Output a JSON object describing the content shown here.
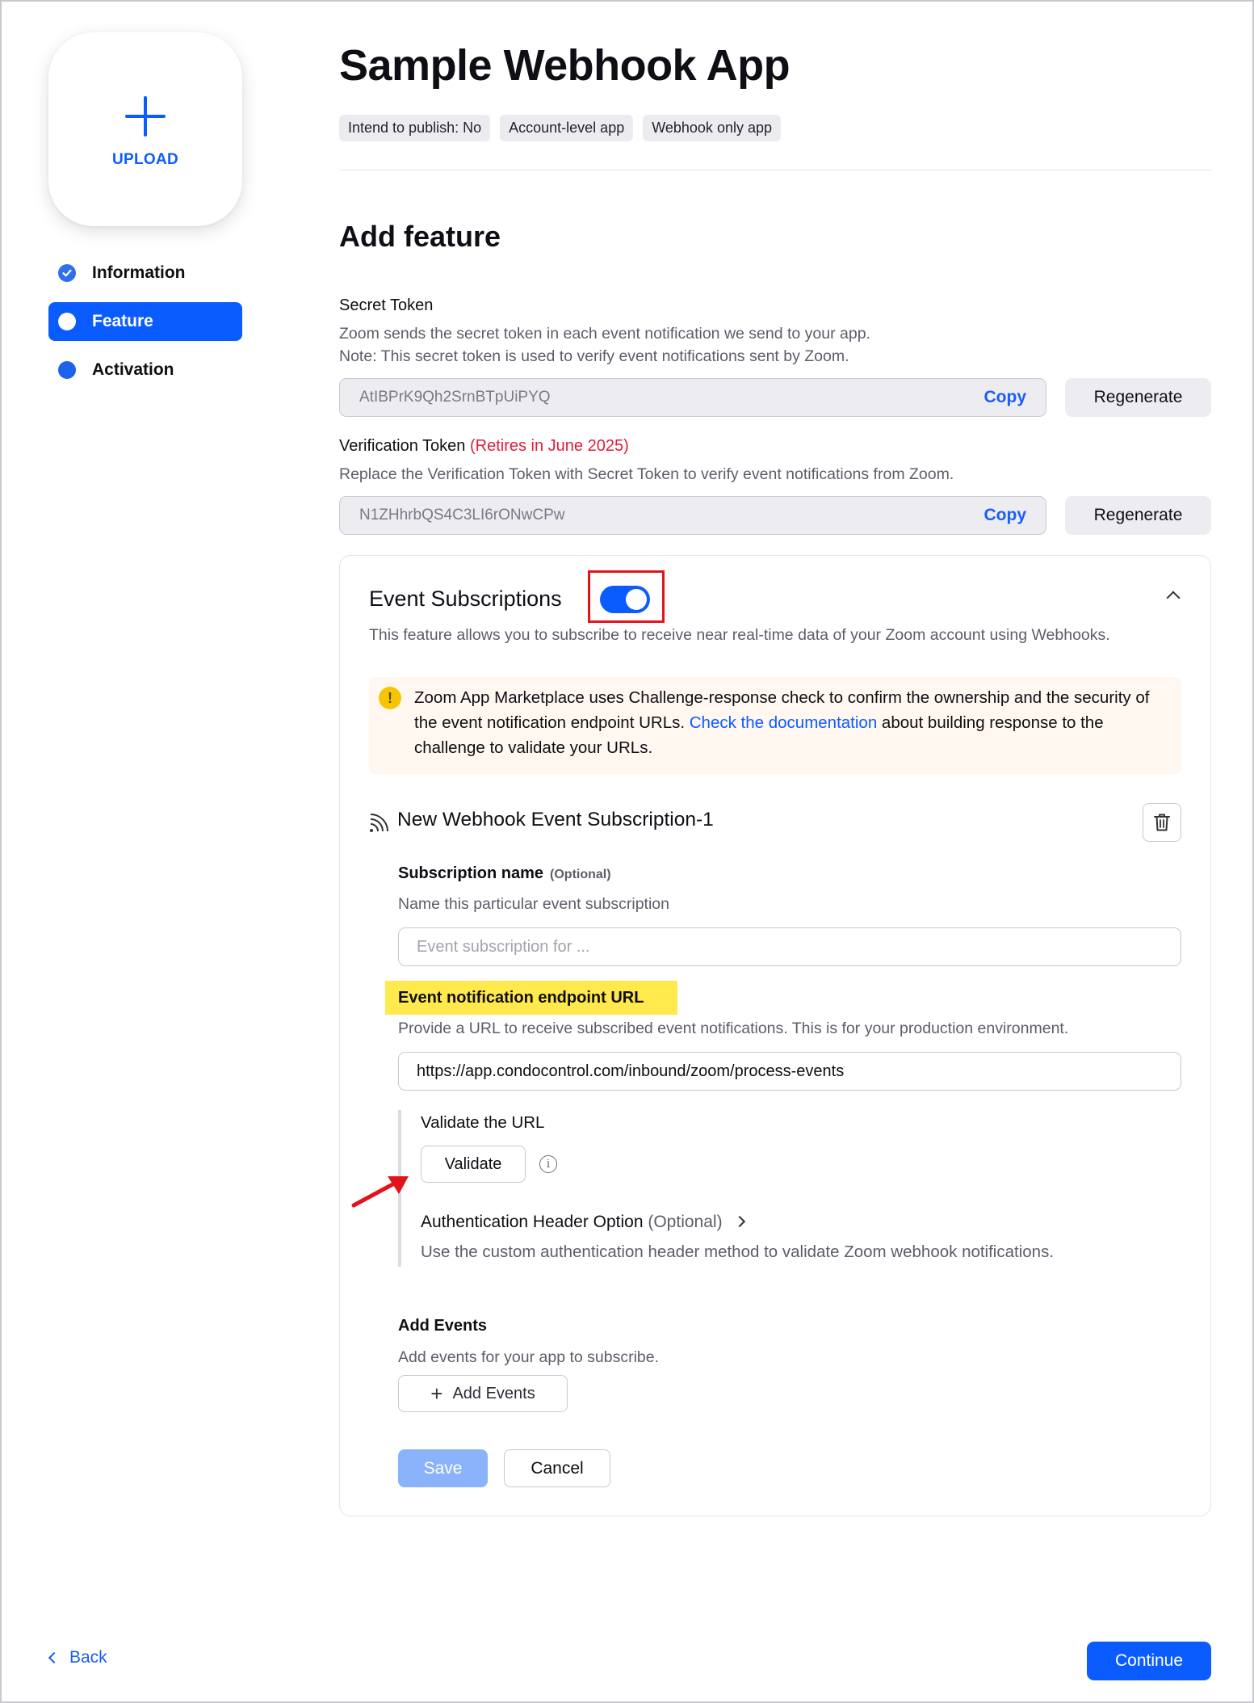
{
  "sidebar": {
    "upload_label": "UPLOAD",
    "items": [
      {
        "label": "Information",
        "state": "completed"
      },
      {
        "label": "Feature",
        "state": "active"
      },
      {
        "label": "Activation",
        "state": "pending"
      }
    ]
  },
  "header": {
    "title": "Sample Webhook App",
    "tags": [
      "Intend to publish: No",
      "Account-level app",
      "Webhook only app"
    ]
  },
  "feature": {
    "title": "Add feature",
    "secret_token": {
      "label": "Secret Token",
      "desc_line1": "Zoom sends the secret token in each event notification we send to your app.",
      "desc_line2": "Note: This secret token is used to verify event notifications sent by Zoom.",
      "value": "AtIBPrK9Qh2SrnBTpUiPYQ",
      "copy_label": "Copy",
      "regenerate_label": "Regenerate"
    },
    "verification_token": {
      "label": "Verification Token",
      "retire_note": "(Retires in June 2025)",
      "desc": "Replace the Verification Token with Secret Token to verify event notifications from Zoom.",
      "value": "N1ZHhrbQS4C3LI6rONwCPw",
      "copy_label": "Copy",
      "regenerate_label": "Regenerate"
    }
  },
  "event_subscriptions": {
    "title": "Event Subscriptions",
    "enabled": true,
    "desc": "This feature allows you to subscribe to receive near real-time data of your Zoom account using Webhooks.",
    "alert": {
      "text_before": "Zoom App Marketplace uses Challenge-response check to confirm the ownership and the security of the event notification endpoint URLs. ",
      "link_text": "Check the documentation",
      "text_after": " about building response to the challenge to validate your URLs."
    },
    "subscription": {
      "title": "New Webhook Event Subscription-1",
      "name_label": "Subscription name",
      "name_optional": "(Optional)",
      "name_desc": "Name this particular event subscription",
      "name_placeholder": "Event subscription for ...",
      "endpoint_label": "Event notification endpoint URL",
      "endpoint_desc": "Provide a URL to receive subscribed event notifications. This is for your production environment.",
      "endpoint_value": "https://app.condocontrol.com/inbound/zoom/process-events",
      "validate_title": "Validate the URL",
      "validate_label": "Validate",
      "auth_label": "Authentication Header Option",
      "auth_optional": "(Optional)",
      "auth_desc": "Use the custom authentication header method to validate Zoom webhook notifications.",
      "add_events_title": "Add Events",
      "add_events_desc": "Add events for your app to subscribe.",
      "add_events_label": "Add Events",
      "save_label": "Save",
      "cancel_label": "Cancel"
    }
  },
  "footer": {
    "back_label": "Back",
    "continue_label": "Continue"
  },
  "colors": {
    "primary": "#0b5cff",
    "annotation_red": "#e0141a",
    "highlight_yellow": "#ffe94d"
  }
}
